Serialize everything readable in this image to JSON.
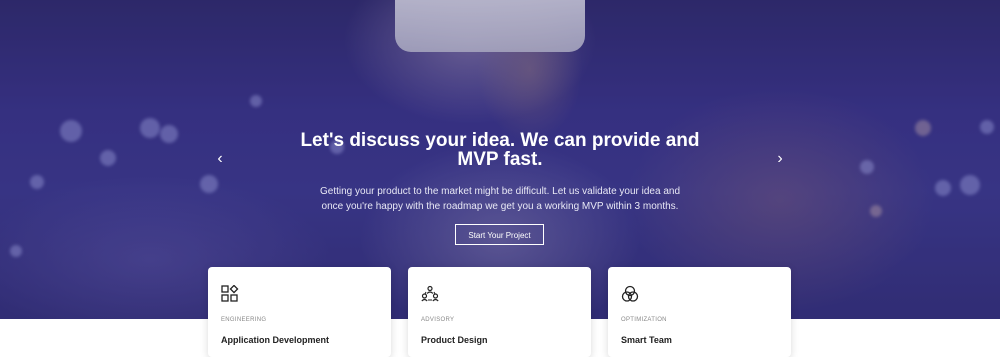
{
  "hero": {
    "title": "Let's discuss your idea. We can provide and MVP fast.",
    "subtitle": "Getting your product to the market might be difficult. Let us validate your idea and once you're happy with the roadmap we get you a working MVP within 3 months.",
    "cta_label": "Start Your Project",
    "prev_arrow": "‹",
    "next_arrow": "›"
  },
  "cards": [
    {
      "category": "ENGINEERING",
      "title": "Application Development",
      "icon": "shapes-icon"
    },
    {
      "category": "ADVISORY",
      "title": "Product Design",
      "icon": "team-icon"
    },
    {
      "category": "OPTIMIZATION",
      "title": "Smart Team",
      "icon": "venn-icon"
    }
  ]
}
